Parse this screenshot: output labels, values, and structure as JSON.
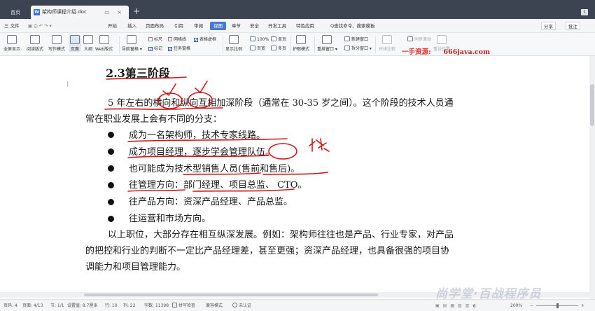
{
  "tabs": {
    "home": "首页",
    "doc": "架构师课程介绍.doc",
    "badge": "1"
  },
  "menu": {
    "file": "三 文件",
    "items": [
      "开始",
      "插入",
      "页面布局",
      "引用",
      "审阅",
      "视图",
      "章节",
      "安全",
      "开发工具",
      "特色应用"
    ],
    "active": "视图",
    "search": "Q查找命令、搜索模板",
    "share": "分享",
    "comment": "批注"
  },
  "ribbon": {
    "fullscreen": "全屏显示",
    "reading": "阅读版式",
    "writing": "写作模式",
    "page": "页面",
    "outline": "大纲",
    "web": "Web版式",
    "nav": "导航窗格",
    "ruler": "标尺",
    "gridlines": "网格线",
    "tablegrid": "表格虚框",
    "marks": "标记",
    "taskpane": "任务窗格",
    "zoom_label": "显示比例",
    "zoom_100": "100%",
    "single_page": "单页",
    "page_width": "页宽",
    "multi_page": "多页",
    "eye": "护眼模式",
    "rearrange": "重排窗口",
    "new_window": "新建窗口",
    "split": "拆分窗口",
    "sync_scroll": "同步滚动",
    "side_by_side": "并排比较",
    "reset_pos": "重设位置"
  },
  "watermark": {
    "prefix": "一手资源:",
    "site": "666java.com",
    "bottom": "尚学堂·百战程序员"
  },
  "document": {
    "heading_num": "2.3",
    "heading_text": "第三阶段",
    "para1_line1": "5 年左右的横向和纵向互相加深阶段（通常在 30-35 岁之间）。这个阶段的技术人员通",
    "para1_line2": "常在职业发展上会有不同的分支：",
    "bullets": [
      "成为一名架构师，技术专家线路。",
      "成为项目经理，逐步学会管理队伍。",
      "也可能成为技术型销售人员(售前和售后)。",
      "往管理方向：部门经理、项目总监、 CTO。",
      "往产品方向：资深产品经理、产品总监。",
      "往运营和市场方向。"
    ],
    "para2_line1": "以上职位，大部分存在相互纵深发展。例如：架构师往往也是产品、行业专家，对产品",
    "para2_line2": "的把控和行业的判断不一定比产品经理差，甚至更强；资深产品经理，也具备很强的项目协",
    "para2_line3": "调能力和项目管理能力。"
  },
  "status": {
    "pages": "页码: 4",
    "page_of": "页面: 4/13",
    "section": "节: 1/1",
    "setting": "设置值: 8.7厘米",
    "row": "行: 10",
    "col": "列: 22",
    "words": "字数: 11398",
    "spell": "拼写检查",
    "compat": "兼容模式",
    "unverified": "未认证",
    "zoom": "200%"
  },
  "colors": {
    "tabbar": "#3d4451",
    "accent": "#4a78d6",
    "annotation": "#d01818"
  }
}
